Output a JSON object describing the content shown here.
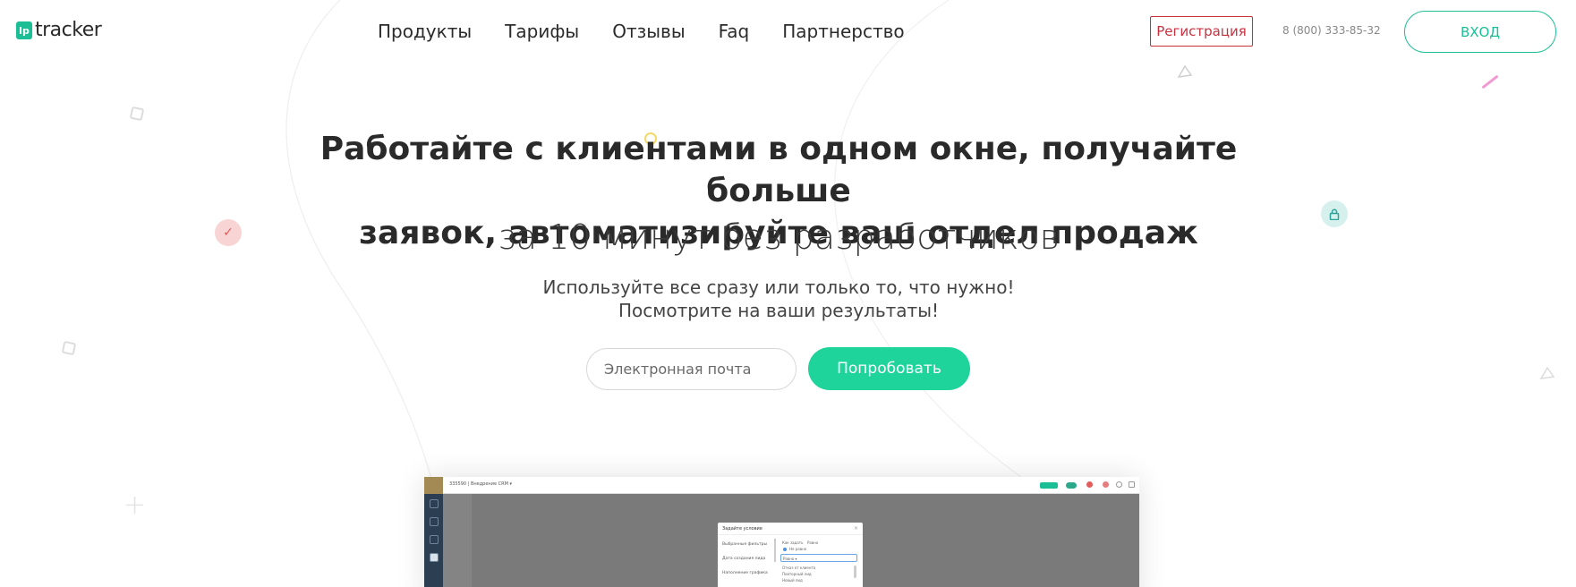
{
  "header": {
    "logo_badge": "lp",
    "logo_text": "tracker",
    "nav": [
      "Продукты",
      "Тарифы",
      "Отзывы",
      "Faq",
      "Партнерство"
    ],
    "register_label": "Регистрация",
    "phone": "8 (800) 333-85-32",
    "login_label": "ВХОД"
  },
  "hero": {
    "title_line1": "Работайте с клиентами в одном окне, получайте больше",
    "title_line2": "заявок, автоматизируйте ваш отдел продаж",
    "subtitle": "за 10 минут без разработчиков",
    "desc_line1": "Используйте все сразу или только то, что нужно!",
    "desc_line2": "Посмотрите на ваши результаты!",
    "email_placeholder": "Электронная почта",
    "try_label": "Попробовать"
  },
  "icons": {
    "check": "check-icon",
    "lock": "lock-icon"
  },
  "colors": {
    "brand_green": "#1cbf95",
    "cta_green": "#1ed49a",
    "register_red": "#c8323f",
    "text_dark": "#2a2a2a"
  },
  "preview": {
    "window_title": "335590 | Внедрение CRM ▾",
    "modal_title": "Задайте условие",
    "modal_left_items": [
      "Выбранные фильтры",
      "Дата создания лида",
      "Наполнение графика"
    ],
    "modal_label": "Как задать",
    "modal_option_a": "Равно",
    "modal_option_b": "Не равно",
    "modal_select_value": "Равно ▾",
    "modal_list": [
      "Отказ от клиента",
      "Повторный лид",
      "Новый лид"
    ]
  }
}
